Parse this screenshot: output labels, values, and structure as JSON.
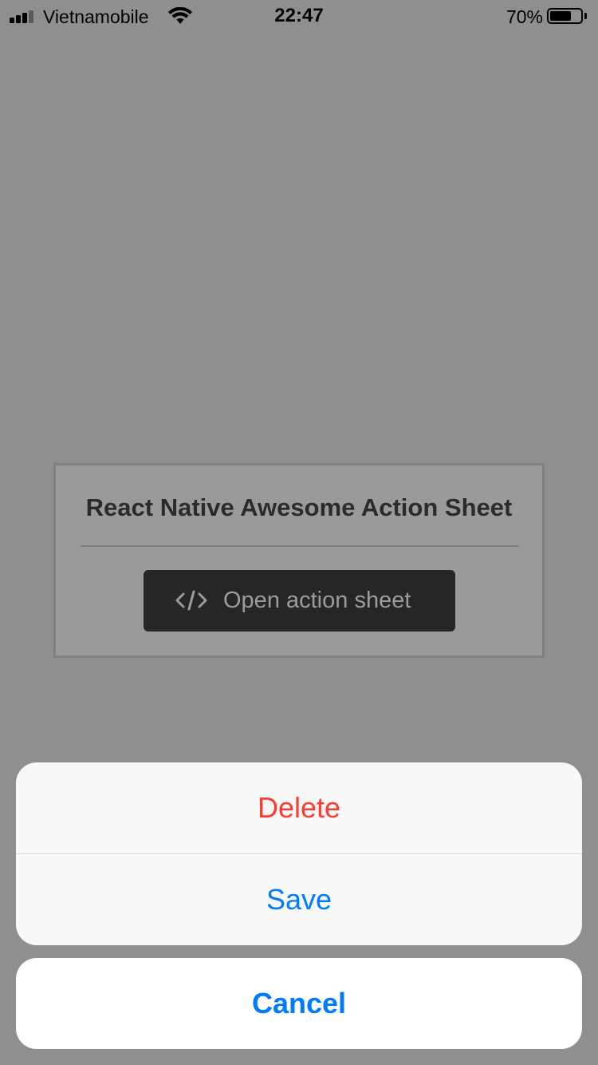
{
  "status_bar": {
    "carrier": "Vietnamobile",
    "time": "22:47",
    "battery_percent": "70%",
    "battery_level": 0.7,
    "signal_bars_active": 3,
    "signal_bars_total": 4,
    "icons": [
      "signal-icon",
      "wifi-icon",
      "battery-icon"
    ]
  },
  "card": {
    "title": "React Native Awesome Action Sheet",
    "open_button": {
      "label": "Open action sheet",
      "icon": "code-icon"
    }
  },
  "action_sheet": {
    "options": [
      {
        "label": "Delete",
        "color": "#ff3b30",
        "destructive": true
      },
      {
        "label": "Save",
        "color": "#007aff",
        "destructive": false
      }
    ],
    "cancel_label": "Cancel",
    "accent_color": "#007aff"
  },
  "colors": {
    "overlay_background": "#8e8f91",
    "sheet_background": "#f8f8f8",
    "button_background": "#262626"
  }
}
